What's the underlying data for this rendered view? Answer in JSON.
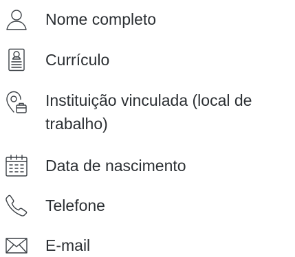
{
  "fields": [
    {
      "icon": "person-icon",
      "label": "Nome completo"
    },
    {
      "icon": "resume-icon",
      "label": "Currículo"
    },
    {
      "icon": "location-briefcase-icon",
      "label": "Instituição vinculada (local de trabalho)"
    },
    {
      "icon": "calendar-icon",
      "label": "Data de nascimento"
    },
    {
      "icon": "phone-icon",
      "label": "Telefone"
    },
    {
      "icon": "email-icon",
      "label": "E-mail"
    }
  ]
}
